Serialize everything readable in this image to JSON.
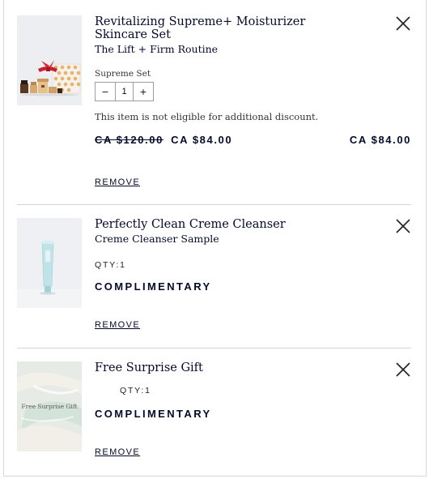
{
  "items": [
    {
      "title": "Revitalizing Supreme+ Moisturizer Skincare Set",
      "subtitle": "The Lift + Firm Routine",
      "variant_label": "Supreme Set",
      "quantity": "1",
      "decrement": "−",
      "increment": "+",
      "note": "This item is not eligible for additional discount.",
      "price_original": "CA $120.00",
      "price_sale": "CA $84.00",
      "price_total": "CA $84.00",
      "remove_label": "REMOVE"
    },
    {
      "title": "Perfectly Clean Creme Cleanser",
      "subtitle": "Creme Cleanser Sample",
      "qty_label": "QTY:1",
      "status": "COMPLIMENTARY",
      "remove_label": "REMOVE"
    },
    {
      "title": "Free Surprise Gift",
      "image_text": "Free Surprise Gift",
      "qty_label": "QTY:1",
      "status": "COMPLIMENTARY",
      "remove_label": "REMOVE"
    }
  ],
  "icons": {
    "close": "close-icon"
  },
  "colors": {
    "text": "#040a2b",
    "divider": "#d4d4d4",
    "gift_bg": "#e6ebe6"
  }
}
